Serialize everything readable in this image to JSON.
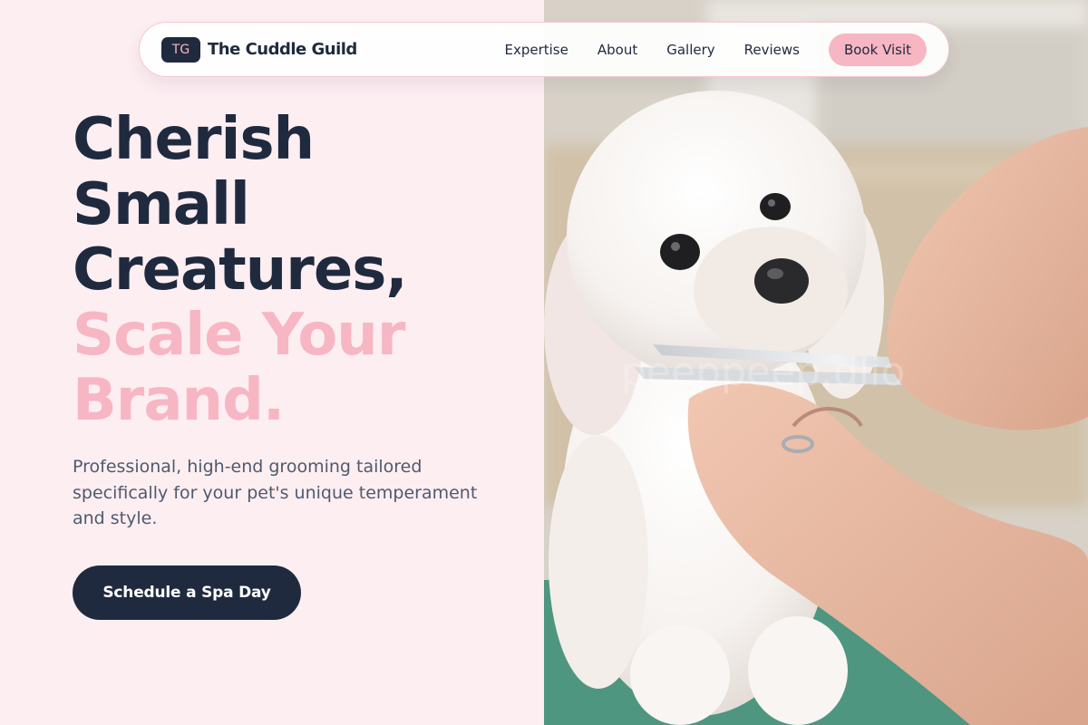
{
  "brand": {
    "initials": "TG",
    "name": "The Cuddle Guild"
  },
  "nav": {
    "links": [
      "Expertise",
      "About",
      "Gallery",
      "Reviews"
    ],
    "cta_label": "Book Visit"
  },
  "hero": {
    "headline_lines": [
      "Cherish",
      "Small",
      "Creatures,"
    ],
    "accent_lines": [
      "Scale Your",
      "Brand."
    ],
    "subtext": "Professional, high-end grooming tailored specifically for your pet's unique temperament and style.",
    "cta_label": "Schedule a Spa Day"
  },
  "photo": {
    "description_icon": "dog-grooming-photo",
    "watermark": "peeppeep.dlio"
  },
  "colors": {
    "navy": "#1f2a3e",
    "pink_accent": "#f7b6c3",
    "background": "#fdeef2",
    "muted_text": "#4f5a6c"
  }
}
